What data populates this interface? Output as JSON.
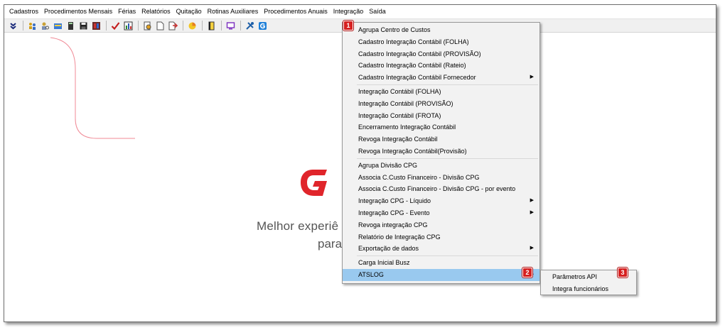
{
  "menubar": {
    "items": [
      "Cadastros",
      "Procedimentos Mensais",
      "Férias",
      "Relatórios",
      "Quitação",
      "Rotinas Auxiliares",
      "Procedimentos Anuais",
      "Integração",
      "Saída"
    ]
  },
  "toolbar": {
    "icons": [
      "arrow-down-icon",
      "people-icon",
      "person-search-icon",
      "card-icon",
      "calculator-icon",
      "save-icon",
      "report-icon",
      "checkmark-icon",
      "chart-icon",
      "document-gear-icon",
      "document-icon",
      "document-export-icon",
      "pie-chart-icon",
      "book-icon",
      "monitor-icon",
      "tools-icon",
      "brand-g-icon"
    ]
  },
  "welcome": {
    "line1": "Melhor experiê",
    "line2": "para"
  },
  "dropdown": {
    "items": [
      {
        "label": "Agrupa Centro de Custos",
        "submenu": false
      },
      {
        "label": "Cadastro Integração Contábil (FOLHA)",
        "submenu": false
      },
      {
        "label": "Cadastro Integração Contábil (PROVISÃO)",
        "submenu": false
      },
      {
        "label": "Cadastro Integração Contábil (Rateio)",
        "submenu": false
      },
      {
        "label": "Cadastro Integração Contábil Fornecedor",
        "submenu": true
      },
      {
        "label": "Integração Contábil (FOLHA)",
        "submenu": false
      },
      {
        "label": "Integração Contábil (PROVISÃO)",
        "submenu": false
      },
      {
        "label": "Integração Contábil (FROTA)",
        "submenu": false
      },
      {
        "label": "Encerramento Integração Contábil",
        "submenu": false
      },
      {
        "label": "Revoga Integração Contábil",
        "submenu": false
      },
      {
        "label": "Revoga Integração Contábil(Provisão)",
        "submenu": false
      },
      {
        "label": "Agrupa Divisão CPG",
        "submenu": false
      },
      {
        "label": "Associa C.Custo Financeiro - Divisão CPG",
        "submenu": false
      },
      {
        "label": "Associa C.Custo Financeiro - Divisão CPG - por evento",
        "submenu": false
      },
      {
        "label": "Integração CPG - Líquido",
        "submenu": true
      },
      {
        "label": "Integração CPG - Evento",
        "submenu": true
      },
      {
        "label": "Revoga integração CPG",
        "submenu": false
      },
      {
        "label": "Relatório de Integração CPG",
        "submenu": false
      },
      {
        "label": "Exportação de dados",
        "submenu": true
      },
      {
        "label": "Carga Inicial Busz",
        "submenu": false
      },
      {
        "label": "ATSLOG",
        "submenu": true
      }
    ],
    "arrow": "▶"
  },
  "submenu": {
    "items": [
      "Parâmetros API",
      "Integra funcionários"
    ]
  },
  "badges": [
    "1",
    "2",
    "3"
  ],
  "colors": {
    "highlight": "#99c9ef",
    "badge": "#d62020",
    "logo": "#e0252b",
    "deco_line": "#f08a96"
  }
}
